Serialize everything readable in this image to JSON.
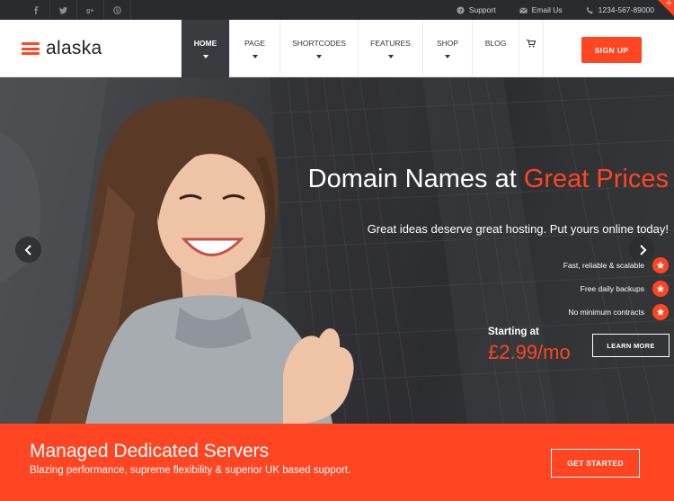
{
  "topbar": {
    "social": [
      {
        "icon": "facebook-icon"
      },
      {
        "icon": "twitter-icon"
      },
      {
        "icon": "google-plus-icon"
      },
      {
        "icon": "skype-icon"
      }
    ],
    "support_label": "Support",
    "email_label": "Email Us",
    "phone_label": "1234-567-89000",
    "corner_label": "+"
  },
  "header": {
    "logo_text": "alaska",
    "nav": {
      "home": "HOME",
      "page": "PAGE",
      "shortcodes": "SHORTCODES",
      "features": "FEATURES",
      "shop": "SHOP",
      "blog": "BLOG"
    },
    "signup_label": "SIGN UP"
  },
  "hero": {
    "title_main": "Domain Names at",
    "title_accent": "Great Prices",
    "subtitle": "Great ideas deserve great hosting. Put yours online today!",
    "features": [
      "Fast, reliable & scalable",
      "Free daily backups",
      "No minimum contracts"
    ],
    "starting_label": "Starting at",
    "price": "£2.99/mo",
    "learn_more_label": "LEARN MORE"
  },
  "banner": {
    "title": "Managed Dedicated Servers",
    "subtitle": "Blazing performance, supreme flexibility & superior UK based support.",
    "cta_label": "GET STARTED"
  },
  "colors": {
    "accent": "#ff4522",
    "topbar_bg": "#2a2b2e",
    "nav_active_bg": "#3a3b3f"
  }
}
